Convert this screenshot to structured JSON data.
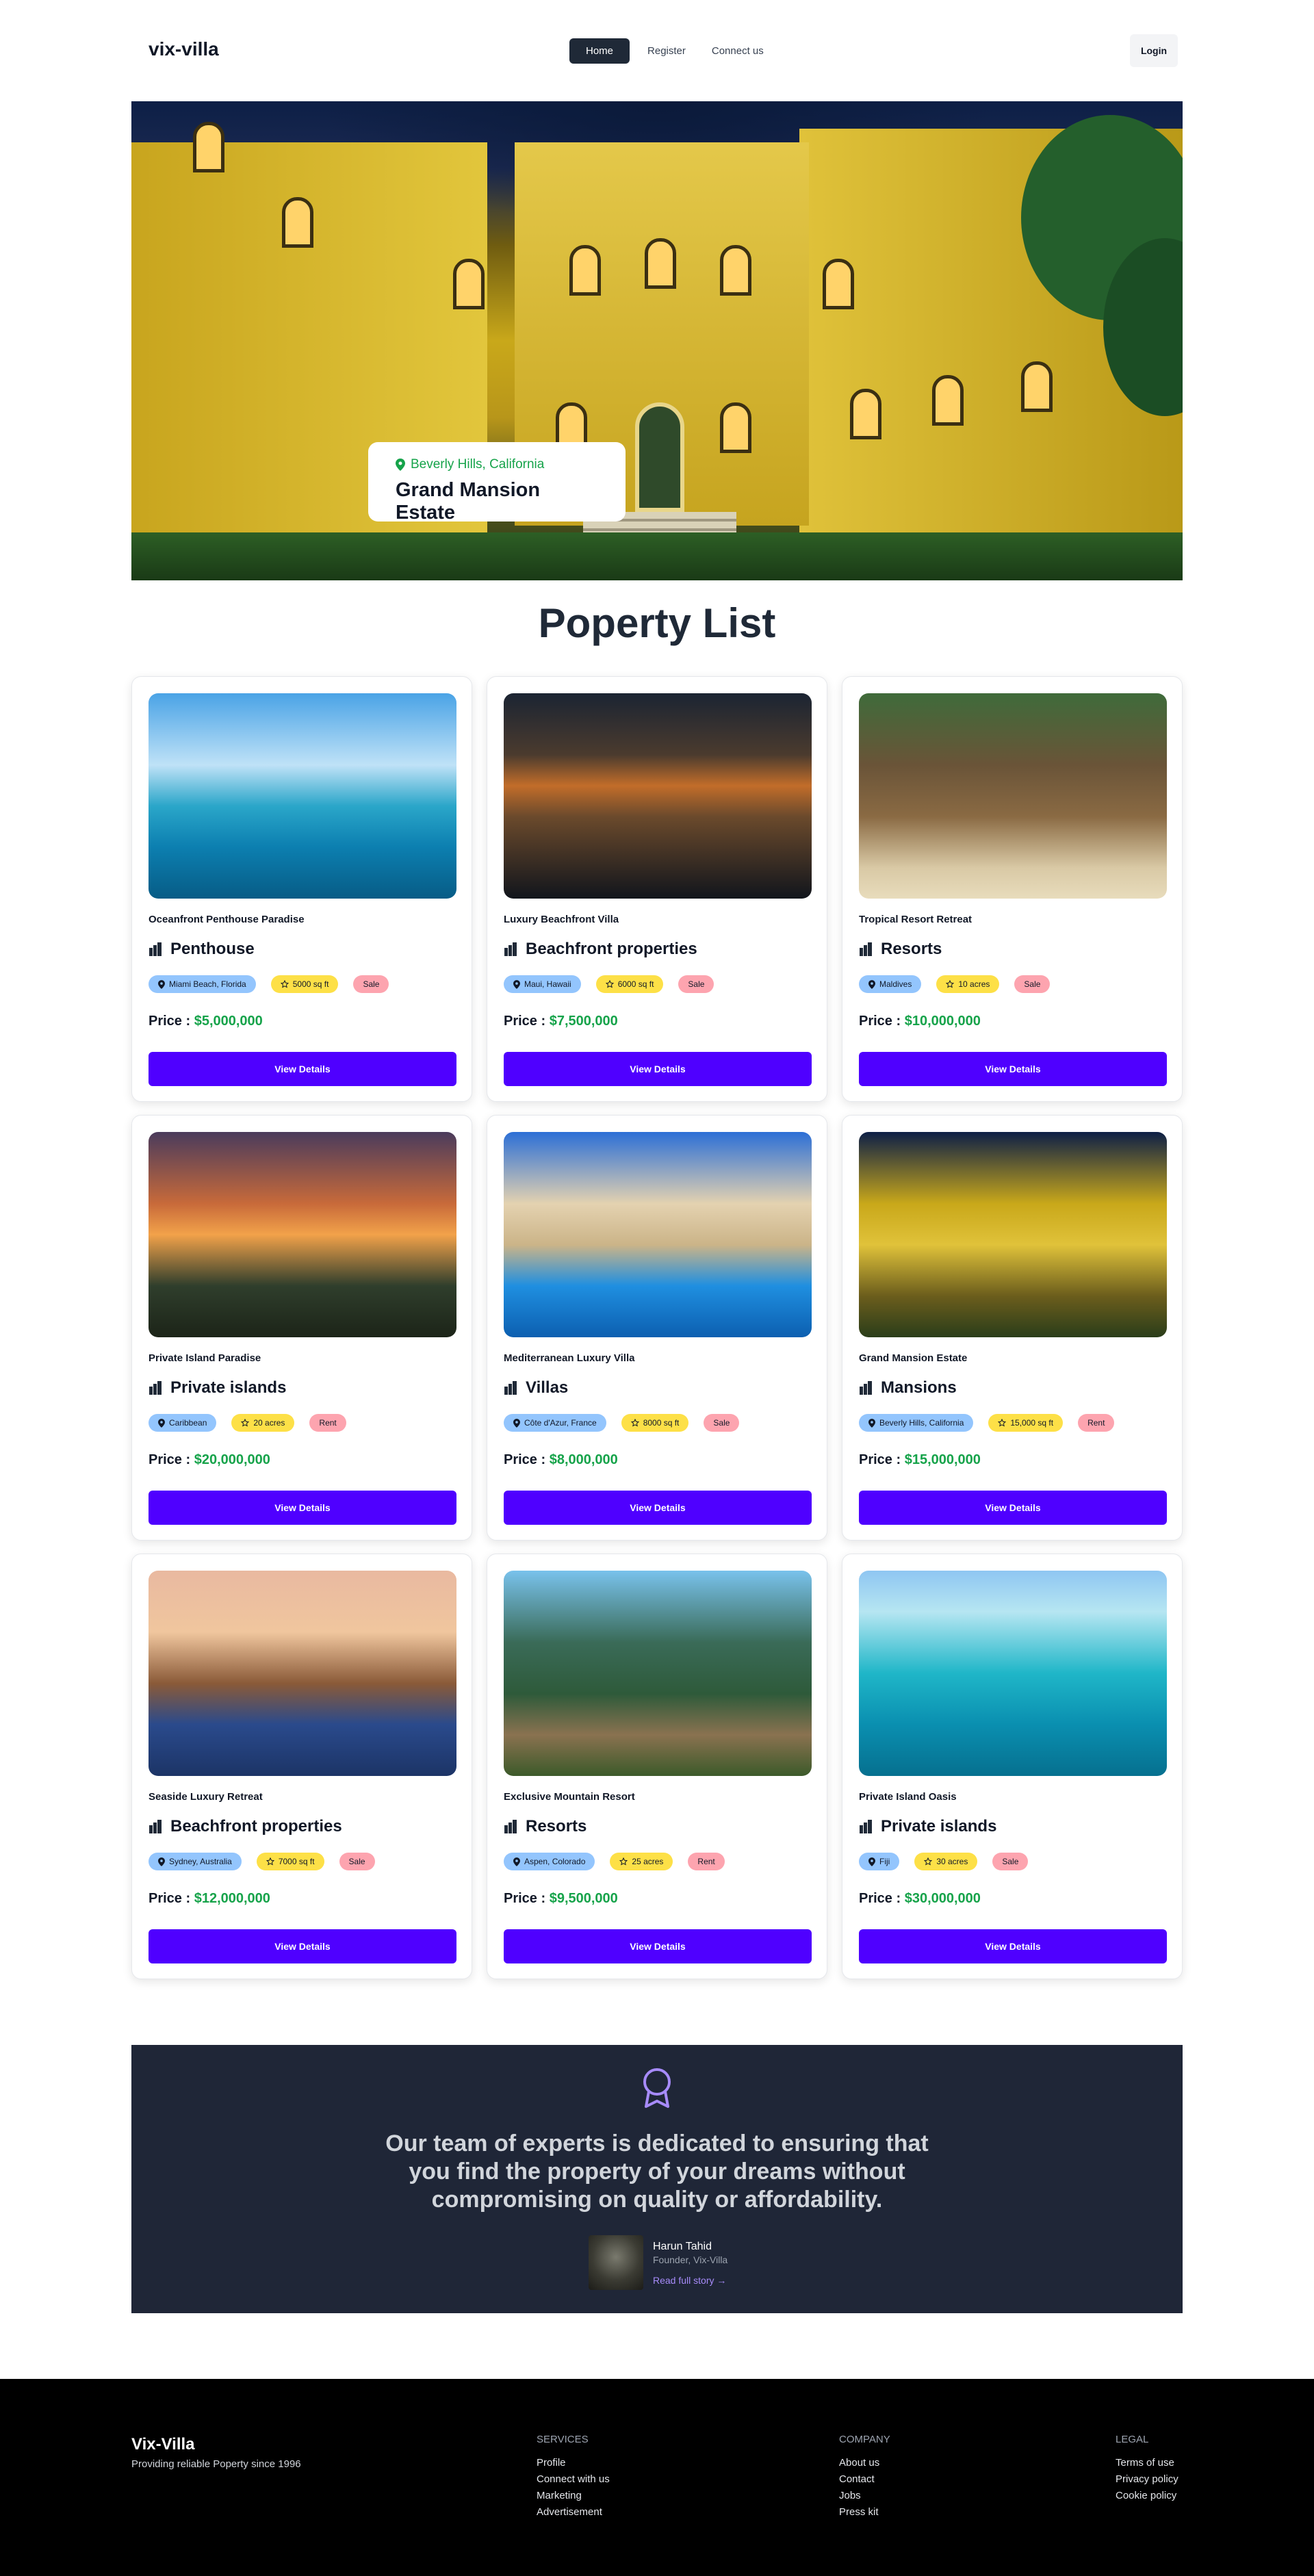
{
  "nav": {
    "brand": "vix-villa",
    "links": [
      "Home",
      "Register",
      "Connect us"
    ],
    "login": "Login"
  },
  "hero": {
    "location": "Beverly Hills, California",
    "title": "Grand Mansion Estate"
  },
  "section_title": "Poperty List",
  "price_label": "Price : ",
  "view_details": "View Details",
  "properties": [
    {
      "name": "Oceanfront Penthouse Paradise",
      "category": "Penthouse",
      "location": "Miami Beach, Florida",
      "size": "5000 sq ft",
      "type": "Sale",
      "price": "$5,000,000"
    },
    {
      "name": "Luxury Beachfront Villa",
      "category": "Beachfront properties",
      "location": "Maui, Hawaii",
      "size": "6000 sq ft",
      "type": "Sale",
      "price": "$7,500,000"
    },
    {
      "name": "Tropical Resort Retreat",
      "category": "Resorts",
      "location": "Maldives",
      "size": "10 acres",
      "type": "Sale",
      "price": "$10,000,000"
    },
    {
      "name": "Private Island Paradise",
      "category": "Private islands",
      "location": "Caribbean",
      "size": "20 acres",
      "type": "Rent",
      "price": "$20,000,000"
    },
    {
      "name": "Mediterranean Luxury Villa",
      "category": "Villas",
      "location": "Côte d'Azur, France",
      "size": "8000 sq ft",
      "type": "Sale",
      "price": "$8,000,000"
    },
    {
      "name": "Grand Mansion Estate",
      "category": "Mansions",
      "location": "Beverly Hills, California",
      "size": "15,000 sq ft",
      "type": "Rent",
      "price": "$15,000,000"
    },
    {
      "name": "Seaside Luxury Retreat",
      "category": "Beachfront properties",
      "location": "Sydney, Australia",
      "size": "7000 sq ft",
      "type": "Sale",
      "price": "$12,000,000"
    },
    {
      "name": "Exclusive Mountain Resort",
      "category": "Resorts",
      "location": "Aspen, Colorado",
      "size": "25 acres",
      "type": "Rent",
      "price": "$9,500,000"
    },
    {
      "name": "Private Island Oasis",
      "category": "Private islands",
      "location": "Fiji",
      "size": "30 acres",
      "type": "Sale",
      "price": "$30,000,000"
    }
  ],
  "testimonial": {
    "quote": "Our team of experts is dedicated to ensuring that you find the property of your dreams without compromising on quality or affordability.",
    "author": "Harun Tahid",
    "role": "Founder, Vix-Villa",
    "link": "Read full story →"
  },
  "footer": {
    "brand": "Vix-Villa",
    "tagline": "Providing reliable Poperty since 1996",
    "columns": [
      {
        "heading": "SERVICES",
        "items": [
          "Profile",
          "Connect with us",
          "Marketing",
          "Advertisement"
        ]
      },
      {
        "heading": "COMPANY",
        "items": [
          "About us",
          "Contact",
          "Jobs",
          "Press kit"
        ]
      },
      {
        "heading": "LEGAL",
        "items": [
          "Terms of use",
          "Privacy policy",
          "Cookie policy"
        ]
      }
    ]
  },
  "colors": {
    "accent": "#4f00ff",
    "price": "#16a34a",
    "dark": "#1f2637",
    "location_tag": "#93c5fd",
    "size_tag": "#fde047",
    "type_tag": "#fda4af"
  },
  "icons": {
    "location": "map-pin-icon",
    "size": "star-icon",
    "category": "building-icon",
    "award": "award-ribbon-icon"
  }
}
